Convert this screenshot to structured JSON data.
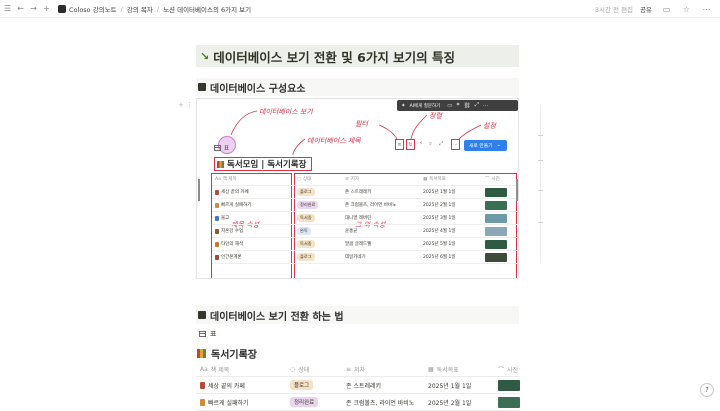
{
  "topbar": {
    "breadcrumbs": [
      "Coloso 강의노트",
      "강의 목차",
      "노션 데이터베이스의 6가지 보기"
    ],
    "edited": "3시간 전 편집",
    "share": "공유"
  },
  "page": {
    "title_arrow": "↘",
    "title": "데이터베이스 보기 전환 및 6가지 보기의 특징",
    "section1": "데이터베이스 구성요소",
    "section2": "데이터베이스 보기 전환 하는 법"
  },
  "screenshot": {
    "ai_label": "AI에게 질문하기",
    "view_tab": "표",
    "new_button": "새로 만들기",
    "db_title": "독서모임 | 독서기록장",
    "annotations": {
      "views": "데이터베이스 보기",
      "db_title": "데이터베이스 제목",
      "filter": "필터",
      "sort": "정렬",
      "settings": "설정",
      "title_prop": "제목 속성",
      "other_props": "그 외 속성"
    },
    "headers": [
      "책 제목",
      "상태",
      "저자",
      "독서목표",
      "사진"
    ],
    "rows": [
      {
        "title": "세상 끝의 카페",
        "status": "플로그",
        "author": "존 스트레레키",
        "goal": "2025년 1월 1일"
      },
      {
        "title": "빠르게 실패하기",
        "status": "정리완료",
        "author": "존 크럼볼츠, 라이언 바비노",
        "goal": "2025년 2월 1일"
      },
      {
        "title": "물고",
        "status": "독서중",
        "author": "대니얼 레버틴",
        "goal": "2025년 3월 1일"
      },
      {
        "title": "지혼강 수업",
        "status": "완독",
        "author": "윤홍균",
        "goal": "2025년 4월 1일"
      },
      {
        "title": "타인의 해석",
        "status": "독서중",
        "author": "말콤 글래드웰",
        "goal": "2025년 5월 1일"
      },
      {
        "title": "인간본계론",
        "status": "플로그",
        "author": "데일카네기",
        "goal": "2025년 6월 1일"
      }
    ]
  },
  "lower": {
    "view_tab": "표",
    "db_title": "독서기록장",
    "headers": [
      "책 제목",
      "상태",
      "저자",
      "독서목표",
      "사진"
    ],
    "rows": [
      {
        "title": "세상 끝의 카페",
        "status": "플로그",
        "author": "존 스트레레키",
        "goal": "2025년 1월 1일"
      },
      {
        "title": "빠르게 실패하기",
        "status": "정리완료",
        "author": "존 크럼볼츠, 라이언 바비노",
        "goal": "2025년 2월 1일"
      }
    ]
  },
  "help": "?",
  "colors": {
    "accent_red": "#d8334a",
    "tag_plog": "#f6e2c6",
    "tag_done_note": "#ead5ef",
    "tag_reading": "#f4e3c4",
    "tag_finished": "#dfe7f5",
    "new_button": "#2f80ed"
  }
}
